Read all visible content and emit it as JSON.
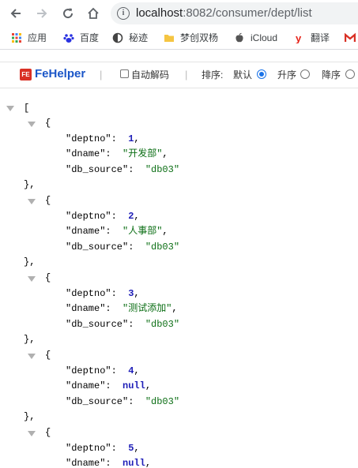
{
  "browser": {
    "url_host": "localhost",
    "url_rest": ":8082/consumer/dept/list"
  },
  "bookmarks": [
    {
      "label": "应用",
      "icon": "apps-grid-icon"
    },
    {
      "label": "百度",
      "icon": "baidu-paw-icon"
    },
    {
      "label": "秘迹",
      "icon": "mijii-icon"
    },
    {
      "label": "梦创双杨",
      "icon": "folder-icon"
    },
    {
      "label": "iCloud",
      "icon": "apple-icon"
    },
    {
      "label": "翻译",
      "icon": "youdao-icon"
    }
  ],
  "fehelper": {
    "title": "FeHelper",
    "logo_text": "FE",
    "auto_decode_label": "自动解码",
    "auto_decode_checked": false,
    "sort_label": "排序:",
    "sort_options": [
      "默认",
      "升序",
      "降序"
    ],
    "sort_selected": "默认"
  },
  "json": {
    "open_bracket": "[",
    "records": [
      {
        "deptno": "1",
        "dname": "\"开发部\"",
        "dname_is_null": false,
        "db_source": "\"db03\""
      },
      {
        "deptno": "2",
        "dname": "\"人事部\"",
        "dname_is_null": false,
        "db_source": "\"db03\""
      },
      {
        "deptno": "3",
        "dname": "\"测试添加\"",
        "dname_is_null": false,
        "db_source": "\"db03\""
      },
      {
        "deptno": "4",
        "dname": "null",
        "dname_is_null": true,
        "db_source": "\"db03\""
      },
      {
        "deptno": "5",
        "dname": "null",
        "dname_is_null": true,
        "db_source": ""
      }
    ],
    "key_deptno": "\"deptno\":",
    "key_dname": "\"dname\":",
    "key_db_source": "\"db_source\":",
    "open_brace": "{",
    "close_brace": "},",
    "comma": ","
  },
  "colors": {
    "string": "#0b6e14",
    "number": "#1f1fb8",
    "accent": "#1a73e8",
    "fehelper_blue": "#1a56c8"
  }
}
